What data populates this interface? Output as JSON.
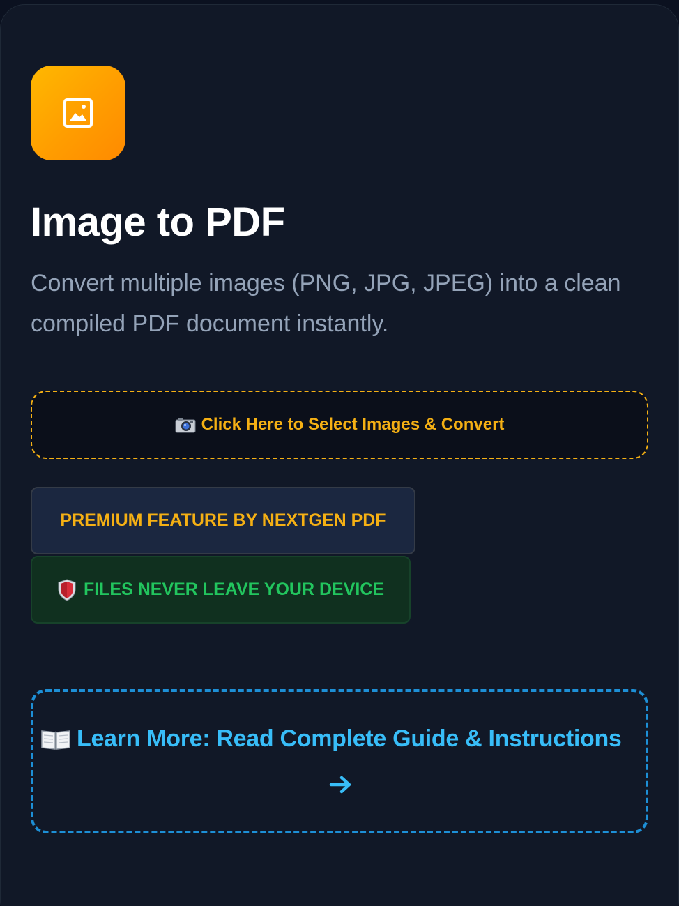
{
  "tool": {
    "icon": "image-icon",
    "title": "Image to PDF",
    "description": "Convert multiple images (PNG, JPG, JPEG) into a clean compiled PDF document instantly."
  },
  "select_button": {
    "icon": "camera-icon",
    "label": "Click Here to Select Images & Convert"
  },
  "badges": {
    "premium": "PREMIUM FEATURE BY NEXTGEN PDF",
    "secure_icon": "shield-icon",
    "secure": "FILES NEVER LEAVE YOUR DEVICE"
  },
  "guide_link": {
    "icon": "book-icon",
    "label": "Learn More: Read Complete Guide & Instructions",
    "arrow_icon": "arrow-right-icon"
  },
  "colors": {
    "background": "#0b1120",
    "card": "#111827",
    "accent_orange": "#f5b014",
    "icon_gradient_start": "#ffb800",
    "icon_gradient_end": "#ff8a00",
    "premium_bg": "#1b2740",
    "secure_green": "#22c55e",
    "secure_bg": "#10301f",
    "link_blue": "#38bdf8",
    "link_border": "#1d8fd6",
    "text_muted": "#94a3b8"
  }
}
